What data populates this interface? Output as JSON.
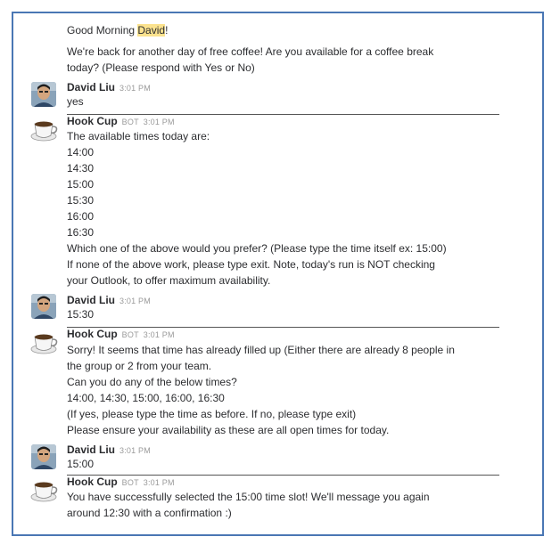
{
  "intro": {
    "greeting_prefix": "Good Morning ",
    "greeting_name": "David",
    "greeting_suffix": "!",
    "line1": "We're back for another day of free coffee! Are you available for a coffee break",
    "line2": "today? (Please respond with Yes or No)"
  },
  "messages": [
    {
      "author": "David Liu",
      "time": "3:01 PM",
      "lines": [
        "yes"
      ]
    },
    {
      "author": "Hook Cup",
      "badge": "BOT",
      "time": "3:01 PM",
      "lines": [
        "The available times today are:",
        "14:00",
        "14:30",
        "15:00",
        "15:30",
        "16:00",
        "16:30",
        "Which one of the above would you prefer? (Please type the time itself ex: 15:00)",
        "If none of the above work, please type exit. Note, today's run is NOT checking",
        "your Outlook, to offer maximum availability."
      ]
    },
    {
      "author": "David Liu",
      "time": "3:01 PM",
      "lines": [
        "15:30"
      ]
    },
    {
      "author": "Hook Cup",
      "badge": "BOT",
      "time": "3:01 PM",
      "lines": [
        "Sorry! It seems that time has already filled up (Either there are already 8 people in",
        "the group or 2 from your team.",
        "Can you do any of the below times?",
        "14:00, 14:30, 15:00, 16:00, 16:30",
        "(If yes, please type the time as before. If no, please type exit)",
        "Please ensure your availability as these are all open times for today."
      ]
    },
    {
      "author": "David Liu",
      "time": "3:01 PM",
      "lines": [
        "15:00"
      ]
    },
    {
      "author": "Hook Cup",
      "badge": "BOT",
      "time": "3:01 PM",
      "lines": [
        "You have successfully selected the 15:00 time slot! We'll message you again",
        "around 12:30 with a confirmation :)"
      ]
    }
  ]
}
